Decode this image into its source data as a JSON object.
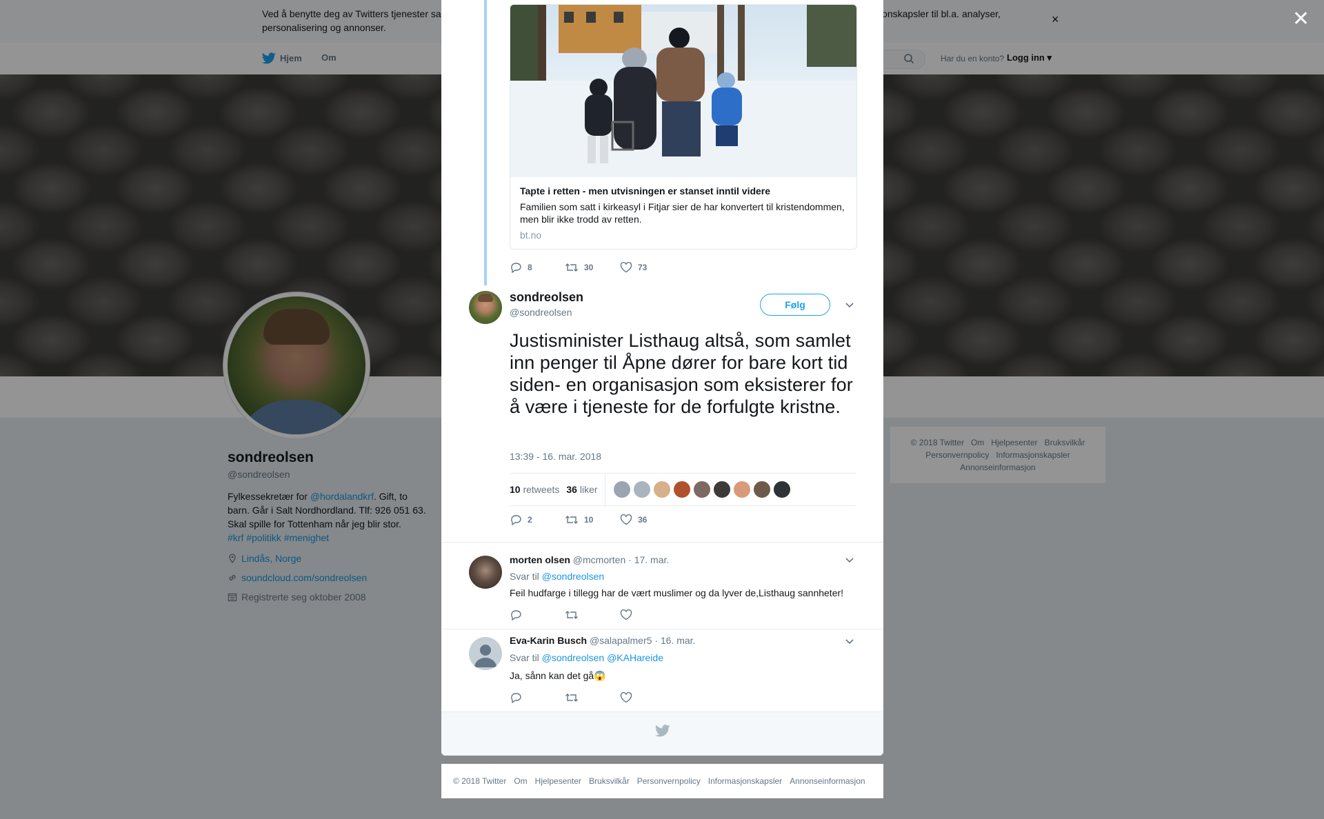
{
  "cookie_bar": {
    "text": "Ved å benytte deg av Twitters tjenester samtykker du i vår bruk av informasjonskapsler. Vi og våre partnere opererer globalt og benytter informasjonskapsler til bl.a. analyser, personalisering og annonser.",
    "close": "×"
  },
  "nav": {
    "home": "Hjem",
    "about": "Om",
    "login_prompt": "Har du en konto?",
    "login": "Logg inn ▾"
  },
  "profile": {
    "name": "sondreolsen",
    "handle": "@sondreolsen",
    "bio_prefix": "Fylkessekretær for ",
    "bio_mention": "@hordalandkrf",
    "bio_suffix": ". Gift, to barn. Går i Salt Nordhordland. Tlf: 926 051 63. Skal spille for Tottenham når jeg blir stor.",
    "bio_tags": "#krf #politikk #menighet",
    "location": "Lindås, Norge",
    "website": "soundcloud.com/sondreolsen",
    "joined": "Registrerte seg oktober 2008"
  },
  "side_footer": [
    "© 2018 Twitter",
    "Om",
    "Hjelpesenter",
    "Bruksvilkår",
    "Personvernpolicy",
    "Informasjonskapsler",
    "Annonseinformasjon"
  ],
  "overlay_close": "✕",
  "quoted_card": {
    "title": "Tapte i retten - men utvisningen er stanset inntil videre",
    "description": "Familien som satt i kirkeasyl i Fitjar sier de har konvertert til kristendommen, men blir ikke trodd av retten.",
    "host": "bt.no",
    "replies": "8",
    "retweets": "30",
    "likes": "73"
  },
  "main_tweet": {
    "name": "sondreolsen",
    "handle": "@sondreolsen",
    "follow": "Følg",
    "text": "Justisminister Listhaug altså, som samlet inn penger til Åpne dører for bare kort tid siden- en organisasjon som eksisterer for å være i tjeneste for de forfulgte kristne.",
    "timestamp": "13:39 - 16. mar. 2018",
    "retweet_count": "10",
    "retweet_label": "retweets",
    "like_count": "36",
    "like_label": "liker",
    "replies": "2",
    "retweets": "10",
    "likes": "36"
  },
  "replies": [
    {
      "name": "morten olsen",
      "handle": "@mcmorten",
      "date": "· 17. mar.",
      "reply_to_label": "Svar til",
      "reply_to": "@sondreolsen",
      "text": "Feil hudfarge i tillegg har de vært muslimer og da lyver de,Listhaug sannheter!"
    },
    {
      "name": "Eva-Karin Busch",
      "handle": "@salapalmer5",
      "date": "· 16. mar.",
      "reply_to_label": "Svar til",
      "reply_to": "@sondreolsen @KAHareide",
      "text": "Ja, sånn kan det gå😱"
    }
  ],
  "bottom_footer": [
    "© 2018 Twitter",
    "Om",
    "Hjelpesenter",
    "Bruksvilkår",
    "Personvernpolicy",
    "Informasjonskapsler",
    "Annonseinformasjon"
  ],
  "colors": {
    "accent": "#1da1f2",
    "link": "#1b95e0",
    "thread_line": "#a6d1f5",
    "muted": "#657786"
  }
}
